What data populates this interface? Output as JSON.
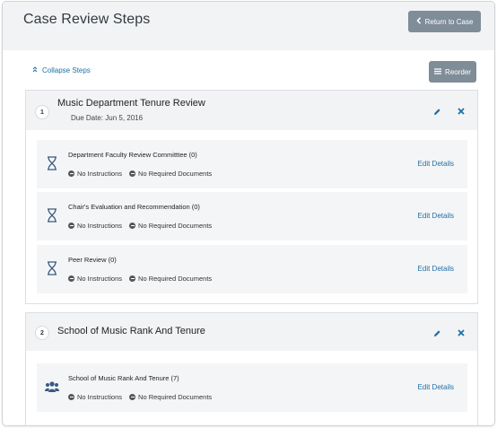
{
  "page": {
    "title": "Case Review Steps",
    "return_label": "Return to Case",
    "collapse_label": "Collapse Steps",
    "reorder_label": "Reorder"
  },
  "colors": {
    "link": "#1f6fa8",
    "button_bg": "#7f8d99",
    "header_bg": "#f2f3f4",
    "sub_bg": "#f4f5f6"
  },
  "steps": [
    {
      "number": "1",
      "title": "Music Department Tenure Review",
      "due": "Due Date: Jun 5, 2016",
      "substeps": [
        {
          "icon": "hourglass-icon",
          "title": "Department Faculty Review Committtee (0)",
          "instructions": "No Instructions",
          "documents": "No Required Documents",
          "edit_label": "Edit Details"
        },
        {
          "icon": "hourglass-icon",
          "title": "Chair's Evaluation and Recommendation (0)",
          "instructions": "No Instructions",
          "documents": "No Required Documents",
          "edit_label": "Edit Details"
        },
        {
          "icon": "hourglass-icon",
          "title": "Peer Review (0)",
          "instructions": "No Instructions",
          "documents": "No Required Documents",
          "edit_label": "Edit Details"
        }
      ]
    },
    {
      "number": "2",
      "title": "School of Music Rank And Tenure",
      "substeps": [
        {
          "icon": "group-icon",
          "title": "School of Music Rank And Tenure (7)",
          "instructions": "No Instructions",
          "documents": "No Required Documents",
          "edit_label": "Edit Details"
        }
      ]
    }
  ]
}
